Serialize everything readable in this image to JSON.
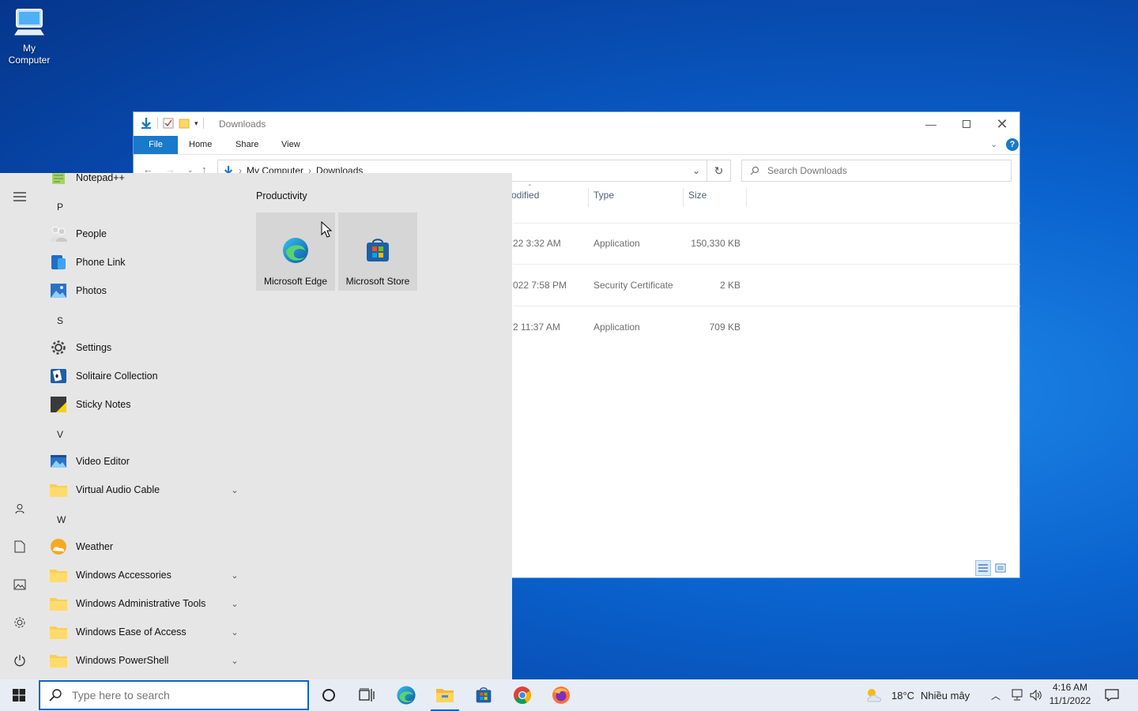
{
  "desktop": {
    "icon_label": "My Computer"
  },
  "explorer": {
    "title": "Downloads",
    "ribbon_tabs": [
      "File",
      "Home",
      "Share",
      "View"
    ],
    "breadcrumb": [
      "My Computer",
      "Downloads"
    ],
    "search_placeholder": "Search Downloads",
    "columns": {
      "date_modified": "odified",
      "type": "Type",
      "size": "Size"
    },
    "rows": [
      {
        "date": "22 3:32 AM",
        "type": "Application",
        "size": "150,330 KB"
      },
      {
        "date": "022 7:58 PM",
        "type": "Security Certificate",
        "size": "2 KB"
      },
      {
        "date": "2 11:37 AM",
        "type": "Application",
        "size": "709 KB"
      }
    ]
  },
  "start_menu": {
    "apps": [
      {
        "label": "Notepad++",
        "icon": "notepadpp-icon",
        "expandable": false
      },
      {
        "letter": "P"
      },
      {
        "label": "People",
        "icon": "people-icon",
        "expandable": false
      },
      {
        "label": "Phone Link",
        "icon": "phone-link-icon",
        "expandable": false
      },
      {
        "label": "Photos",
        "icon": "photos-icon",
        "expandable": false
      },
      {
        "letter": "S"
      },
      {
        "label": "Settings",
        "icon": "settings-icon",
        "expandable": false
      },
      {
        "label": "Solitaire Collection",
        "icon": "solitaire-icon",
        "expandable": false
      },
      {
        "label": "Sticky Notes",
        "icon": "sticky-notes-icon",
        "expandable": false
      },
      {
        "letter": "V"
      },
      {
        "label": "Video Editor",
        "icon": "video-editor-icon",
        "expandable": false
      },
      {
        "label": "Virtual Audio Cable",
        "icon": "folder-icon",
        "expandable": true
      },
      {
        "letter": "W"
      },
      {
        "label": "Weather",
        "icon": "weather-icon",
        "expandable": false
      },
      {
        "label": "Windows Accessories",
        "icon": "folder-icon",
        "expandable": true
      },
      {
        "label": "Windows Administrative Tools",
        "icon": "folder-icon",
        "expandable": true
      },
      {
        "label": "Windows Ease of Access",
        "icon": "folder-icon",
        "expandable": true
      },
      {
        "label": "Windows PowerShell",
        "icon": "folder-icon",
        "expandable": true
      }
    ],
    "tiles_group": "Productivity",
    "tiles": [
      {
        "label": "Microsoft Edge",
        "icon": "edge-icon"
      },
      {
        "label": "Microsoft Store",
        "icon": "store-icon"
      }
    ]
  },
  "taskbar": {
    "search_placeholder": "Type here to search",
    "weather_temp": "18°C",
    "weather_desc": "Nhiều mây",
    "time": "4:16 AM",
    "date": "11/1/2022"
  },
  "colors": {
    "accent": "#1979ca",
    "start_bg": "#e6e6e6",
    "taskbar_bg": "#e8edf5"
  }
}
